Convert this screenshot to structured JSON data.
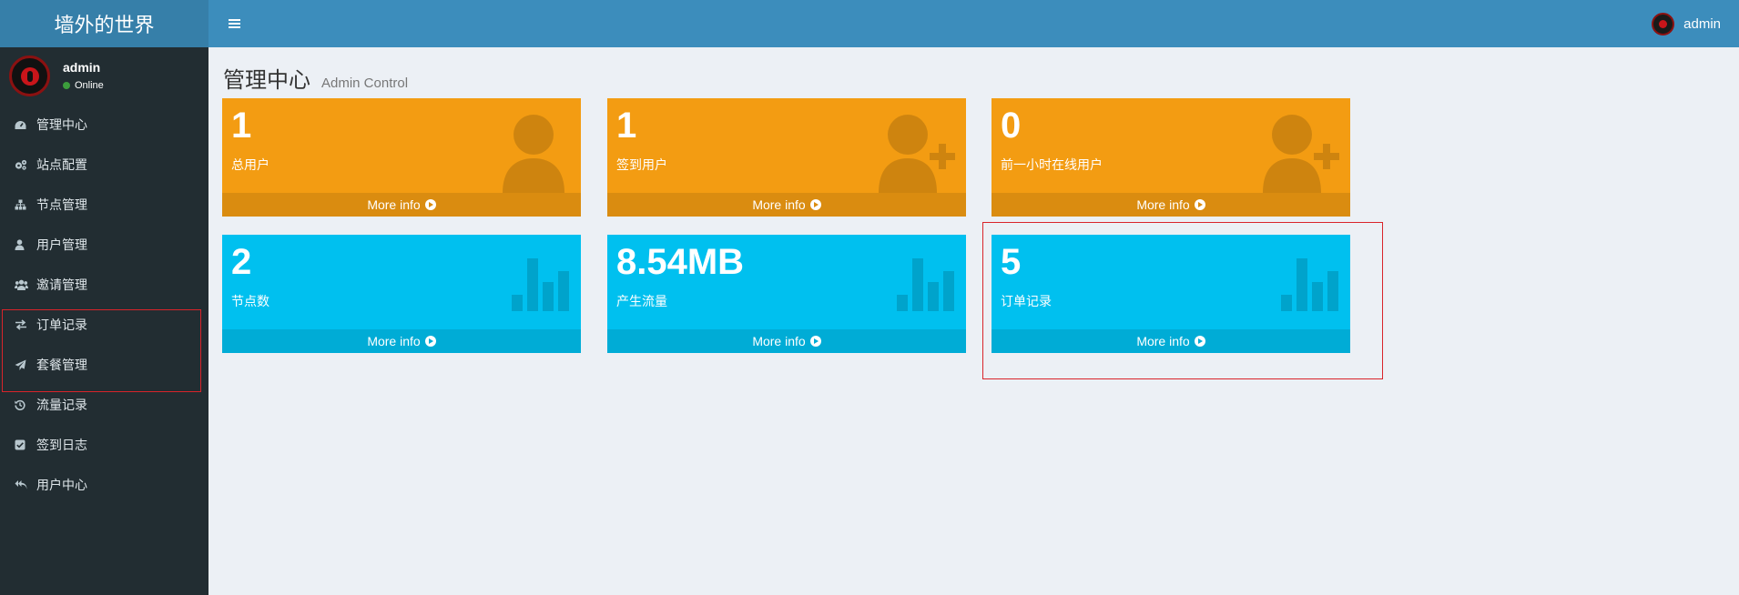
{
  "header": {
    "logo_text": "墙外的世界",
    "user_name": "admin"
  },
  "sidebar": {
    "user_name": "admin",
    "status_text": "Online",
    "items": [
      {
        "label": "管理中心",
        "icon": "dashboard-icon"
      },
      {
        "label": "站点配置",
        "icon": "cogs-icon"
      },
      {
        "label": "节点管理",
        "icon": "sitemap-icon"
      },
      {
        "label": "用户管理",
        "icon": "user-icon"
      },
      {
        "label": "邀请管理",
        "icon": "users-icon"
      },
      {
        "label": "订单记录",
        "icon": "exchange-icon"
      },
      {
        "label": "套餐管理",
        "icon": "paper-plane-icon"
      },
      {
        "label": "流量记录",
        "icon": "history-icon"
      },
      {
        "label": "签到日志",
        "icon": "check-square-icon"
      },
      {
        "label": "用户中心",
        "icon": "reply-all-icon"
      }
    ]
  },
  "page": {
    "title": "管理中心",
    "subtitle": "Admin Control"
  },
  "boxes": [
    {
      "value": "1",
      "label": "总用户",
      "footer": "More info",
      "color": "#f39c12",
      "icon": "user-icon"
    },
    {
      "value": "1",
      "label": "签到用户",
      "footer": "More info",
      "color": "#f39c12",
      "icon": "user-plus-icon"
    },
    {
      "value": "0",
      "label": "前一小时在线用户",
      "footer": "More info",
      "color": "#f39c12",
      "icon": "user-plus-icon"
    },
    {
      "value": "2",
      "label": "节点数",
      "footer": "More info",
      "color": "#00c0ef",
      "icon": "bar-chart-icon"
    },
    {
      "value": "8.54MB",
      "label": "产生流量",
      "footer": "More info",
      "color": "#00c0ef",
      "icon": "bar-chart-icon"
    },
    {
      "value": "5",
      "label": "订单记录",
      "footer": "More info",
      "color": "#00c0ef",
      "icon": "bar-chart-icon"
    }
  ],
  "colors": {
    "header": "#3c8dbc",
    "logo": "#367fa9",
    "sidebar": "#222d32",
    "highlight": "#d9242a"
  }
}
